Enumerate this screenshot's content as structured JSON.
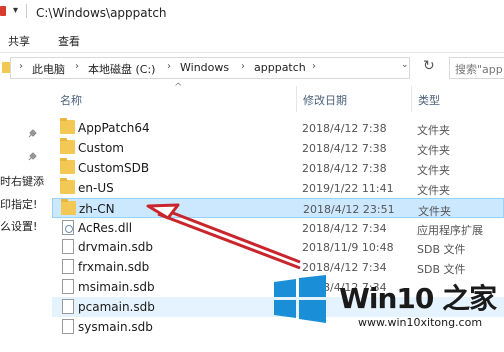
{
  "window": {
    "title": "C:\\Windows\\apppatch"
  },
  "ribbon": {
    "tabs": [
      "共享",
      "查看"
    ]
  },
  "address": {
    "crumbs": [
      "此电脑",
      "本地磁盘 (C:)",
      "Windows",
      "apppatch"
    ],
    "search_placeholder": "搜索\"app"
  },
  "nav": {
    "fragments": [
      "时右键添",
      "印指定!",
      "么设置!"
    ]
  },
  "columns": {
    "name": "名称",
    "date": "修改日期",
    "type": "类型"
  },
  "files": [
    {
      "name": "AppPatch64",
      "date": "2018/4/12 7:38",
      "type": "文件夹",
      "icon": "folder-icon"
    },
    {
      "name": "Custom",
      "date": "2018/4/12 7:38",
      "type": "文件夹",
      "icon": "folder-icon"
    },
    {
      "name": "CustomSDB",
      "date": "2018/4/12 7:38",
      "type": "文件夹",
      "icon": "folder-icon"
    },
    {
      "name": "en-US",
      "date": "2019/1/22 11:41",
      "type": "文件夹",
      "icon": "folder-icon"
    },
    {
      "name": "zh-CN",
      "date": "2018/4/12 23:51",
      "type": "文件夹",
      "icon": "folder-icon",
      "selected": true
    },
    {
      "name": "AcRes.dll",
      "date": "2018/4/12 7:34",
      "type": "应用程序扩展",
      "icon": "dll-icon"
    },
    {
      "name": "drvmain.sdb",
      "date": "2018/11/9 10:48",
      "type": "SDB 文件",
      "icon": "file-icon"
    },
    {
      "name": "frxmain.sdb",
      "date": "2018/4/12 7:34",
      "type": "SDB 文件",
      "icon": "file-icon"
    },
    {
      "name": "msimain.sdb",
      "date": "2018/4/12 7:34",
      "type": "",
      "icon": "file-icon"
    },
    {
      "name": "pcamain.sdb",
      "date": "",
      "type": "",
      "icon": "file-icon",
      "hover": true
    },
    {
      "name": "sysmain.sdb",
      "date": "",
      "type": "",
      "icon": "file-icon"
    }
  ],
  "watermark": {
    "title": "Win10 之家",
    "url": "www.win10xitong.com"
  },
  "colors": {
    "selection": "#cce8ff",
    "arrow": "#c9252c",
    "win_blue": "#1a8fd8"
  }
}
